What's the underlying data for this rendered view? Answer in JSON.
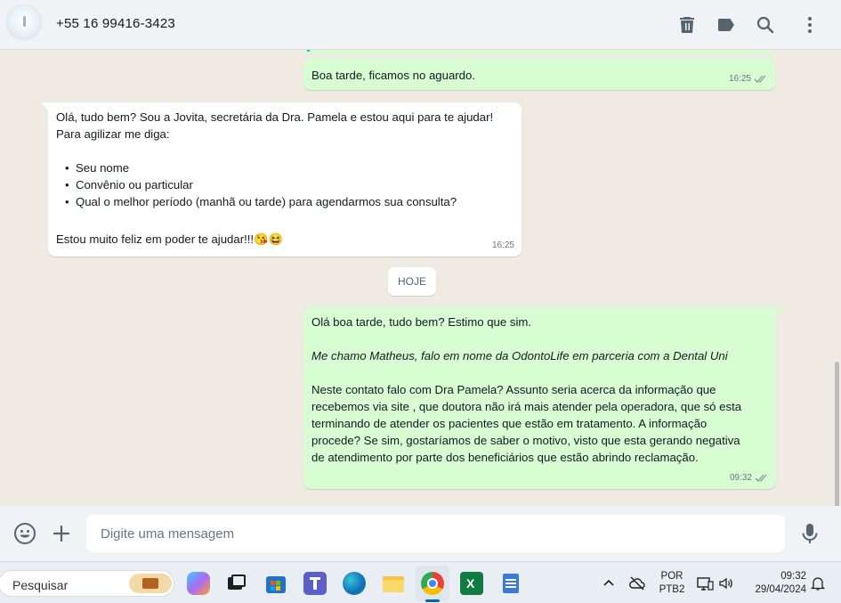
{
  "header": {
    "contact_name": "+55 16 99416-3423",
    "icons": [
      "trash-icon",
      "label-icon",
      "search-icon",
      "more-options-icon"
    ]
  },
  "chat": {
    "messages": [
      {
        "direction": "out",
        "text": "Boa tarde, ficamos no aguardo.",
        "time": "16:25",
        "status": "read"
      },
      {
        "direction": "in",
        "lines": [
          "Olá, tudo bem? Sou a Jovita, secretária da Dra. Pamela e estou aqui para te ajudar!",
          "Para agilizar me diga:"
        ],
        "bullets": [
          "Seu nome",
          "Convênio ou particular",
          "Qual o melhor período (manhã ou tarde) para agendarmos sua consulta?"
        ],
        "closing": "Estou muito feliz em poder te ajudar!!!😘😆",
        "time": "16:25"
      },
      {
        "direction": "out",
        "line1": "Olá boa tarde, tudo bem? Estimo que sim.",
        "line2": "Me chamo Matheus, falo em nome da OdontoLife em parceria com a Dental Uni",
        "paragraph": [
          "Neste contato falo com Dra Pamela? Assunto seria acerca da informação que",
          "recebemos via site , que doutora não irá mais atender pela operadora, que só esta",
          "terminando de atender os pacientes que estão em tratamento. A informação",
          "procede? Se sim, gostaríamos de saber o motivo, visto que esta gerando negativa",
          "de atendimento por parte dos beneficiários que estão abrindo reclamação."
        ],
        "time": "09:32",
        "status": "delivered"
      }
    ],
    "date_divider": "HOJE"
  },
  "composer": {
    "placeholder": "Digite uma mensagem",
    "icons": [
      "emoji-icon",
      "attach-plus-icon",
      "microphone-icon"
    ]
  },
  "taskbar": {
    "search_placeholder": "Pesquisar",
    "apps": [
      "briefcase-icon",
      "copilot-icon",
      "task-view-icon",
      "microsoft-store-icon",
      "teams-icon",
      "edge-icon",
      "file-explorer-icon",
      "chrome-icon",
      "excel-icon",
      "notepad-icon"
    ],
    "language_line1": "POR",
    "language_line2": "PTB2",
    "time": "09:32",
    "date": "29/04/2024"
  },
  "colors": {
    "outgoing_bubble": "#d9fdd3",
    "incoming_bubble": "#ffffff",
    "chat_background": "#efeae2",
    "read_ticks": "#53bdeb",
    "header_background": "#f0f2f5"
  }
}
